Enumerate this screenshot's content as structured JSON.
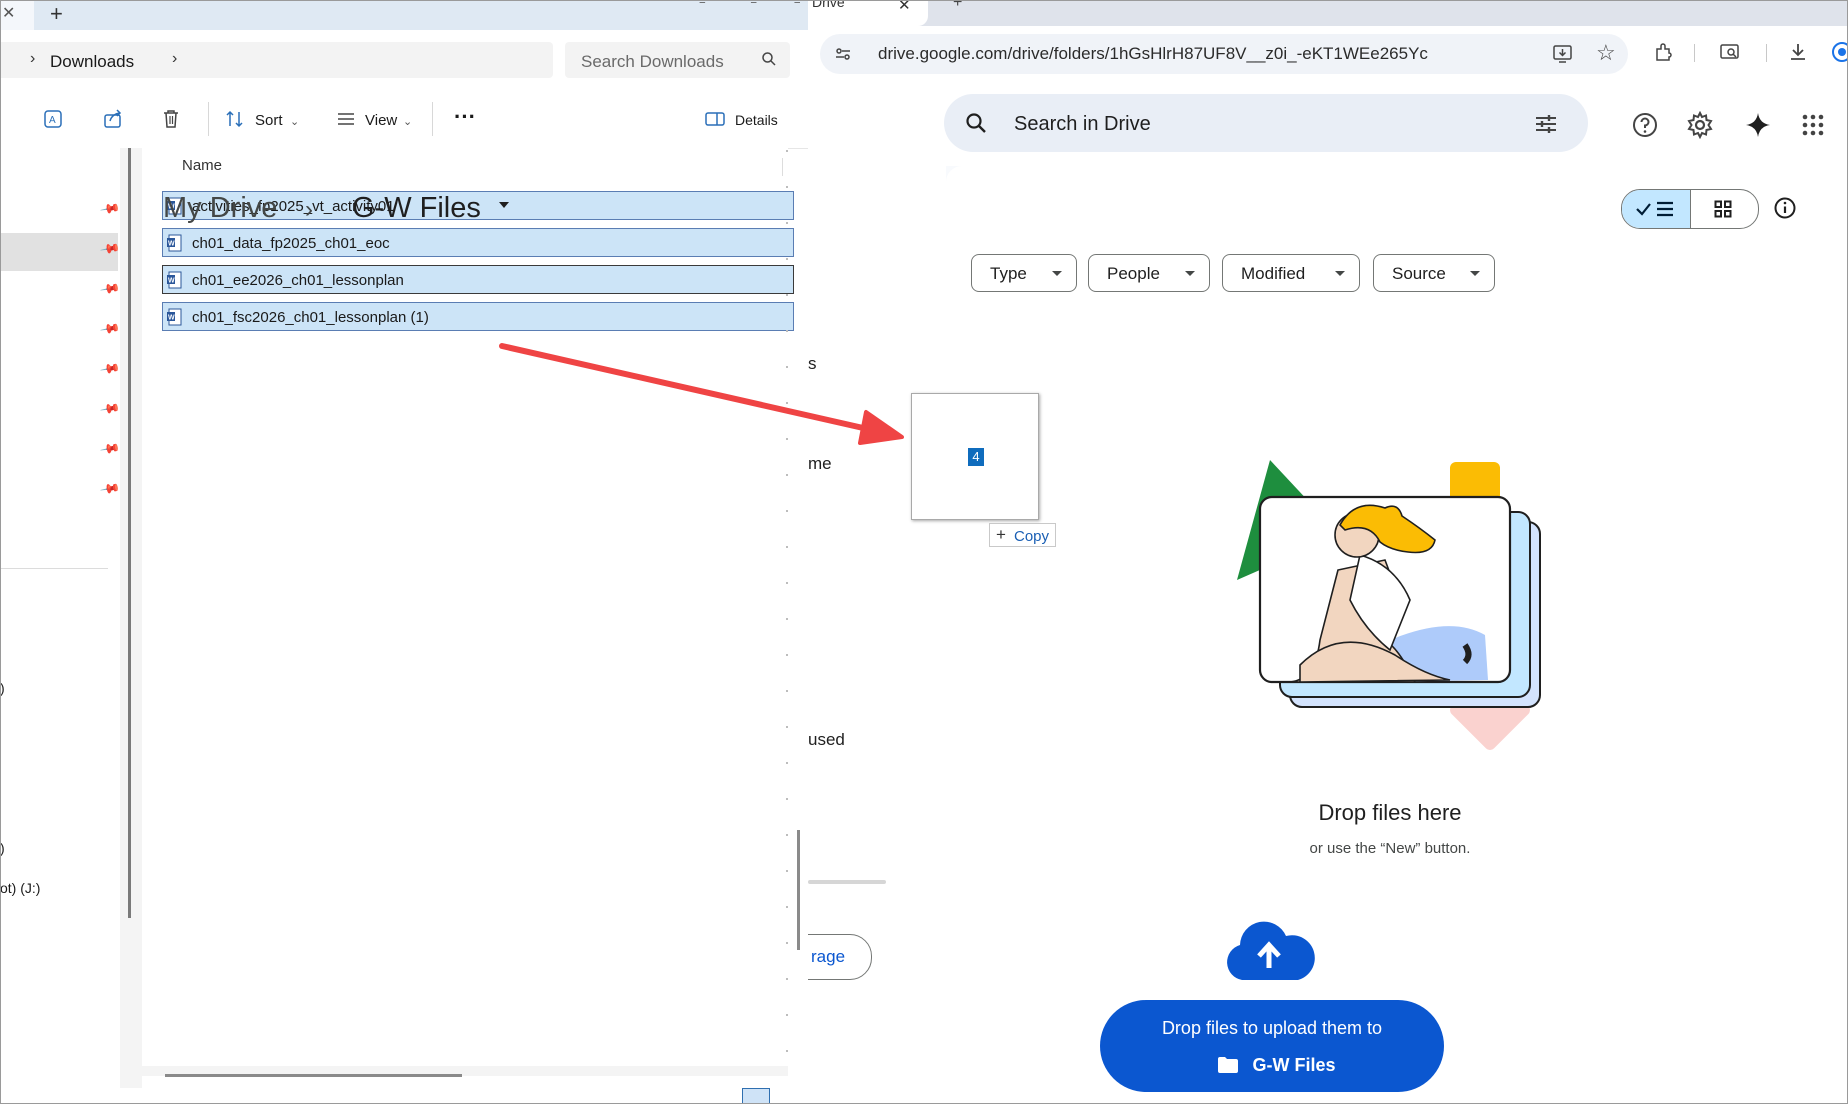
{
  "explorer": {
    "breadcrumb": "Downloads",
    "search_placeholder": "Search Downloads",
    "toolbar": {
      "sort_label": "Sort",
      "view_label": "View",
      "more_label": "···",
      "details_label": "Details"
    },
    "nav_fragments": [
      ")",
      ")",
      "ot) (J:)"
    ],
    "column_name": "Name",
    "files": [
      "activities_fp2025_vt_activity01",
      "ch01_data_fp2025_ch01_eoc",
      "ch01_ee2026_ch01_lessonplan",
      "ch01_fsc2026_ch01_lessonplan (1)"
    ]
  },
  "browser": {
    "tab_title": "Drive",
    "url": "drive.google.com/drive/folders/1hGsHlrH87UF8V__z0i_-eKT1WEe265Yc"
  },
  "drive": {
    "search_placeholder": "Search in Drive",
    "sidebar_fragments": {
      "s": "s",
      "me": "me",
      "used": "used",
      "storage_btn": "rage"
    },
    "breadcrumb_root": "My Drive",
    "breadcrumb_sep": "›",
    "current_folder": "G-W Files",
    "filters": [
      "Type",
      "People",
      "Modified",
      "Source"
    ],
    "drag": {
      "count": "4",
      "copy_label": "Copy"
    },
    "empty_title": "Drop files here",
    "empty_subtitle": "or use the “New” button.",
    "upload_banner_line1": "Drop files to upload them to",
    "upload_banner_folder": "G-W Files"
  },
  "colors": {
    "selection": "#cce4f7",
    "drive_blue": "#0b57d0",
    "chip_border": "#747775",
    "annotation_arrow": "#ef4444"
  }
}
